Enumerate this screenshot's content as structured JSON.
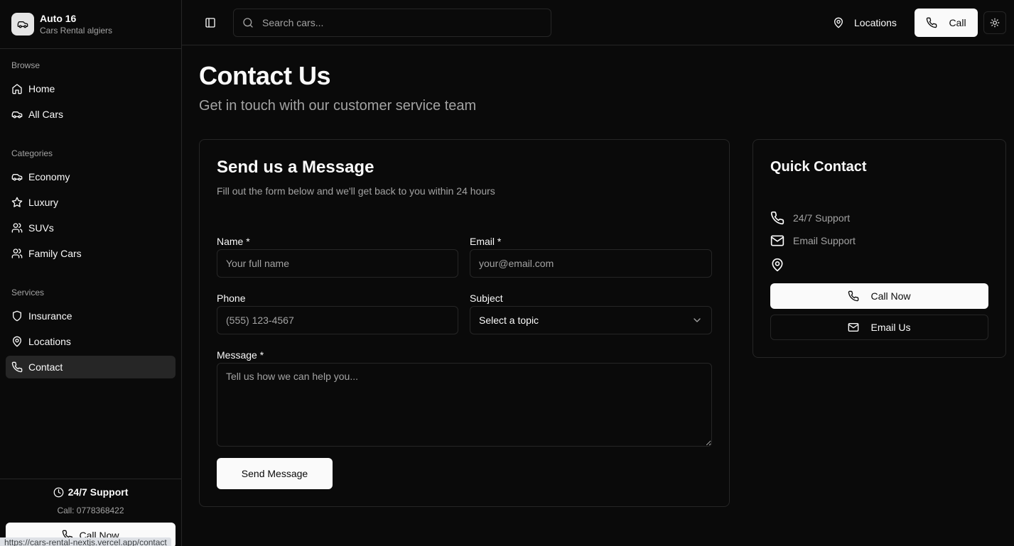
{
  "brand": {
    "title": "Auto 16",
    "subtitle": "Cars Rental algiers"
  },
  "sidebar": {
    "groups": [
      {
        "label": "Browse",
        "items": [
          {
            "label": "Home",
            "icon": "home-icon"
          },
          {
            "label": "All Cars",
            "icon": "car-icon"
          }
        ]
      },
      {
        "label": "Categories",
        "items": [
          {
            "label": "Economy",
            "icon": "car-icon"
          },
          {
            "label": "Luxury",
            "icon": "star-icon"
          },
          {
            "label": "SUVs",
            "icon": "users-icon"
          },
          {
            "label": "Family Cars",
            "icon": "users-icon"
          }
        ]
      },
      {
        "label": "Services",
        "items": [
          {
            "label": "Insurance",
            "icon": "shield-icon"
          },
          {
            "label": "Locations",
            "icon": "map-pin-icon"
          },
          {
            "label": "Contact",
            "icon": "phone-icon",
            "active": true
          }
        ]
      }
    ],
    "footer": {
      "support": "24/7 Support",
      "call_text": "Call: 0778368422",
      "call_button": "Call Now"
    }
  },
  "statusbar": {
    "url": "https://cars-rental-nextjs.vercel.app/contact"
  },
  "header": {
    "search_placeholder": "Search cars...",
    "locations_label": "Locations",
    "call_label": "Call"
  },
  "page": {
    "title": "Contact Us",
    "subtitle": "Get in touch with our customer service team"
  },
  "form": {
    "title": "Send us a Message",
    "description": "Fill out the form below and we'll get back to you within 24 hours",
    "name_label": "Name *",
    "name_placeholder": "Your full name",
    "email_label": "Email *",
    "email_placeholder": "your@email.com",
    "phone_label": "Phone",
    "phone_placeholder": "(555) 123-4567",
    "subject_label": "Subject",
    "subject_value": "Select a topic",
    "message_label": "Message *",
    "message_placeholder": "Tell us how we can help you...",
    "submit": "Send Message"
  },
  "quick_contact": {
    "title": "Quick Contact",
    "support": "24/7 Support",
    "email_support": "Email Support",
    "call_now": "Call Now",
    "email_us": "Email Us"
  },
  "colors": {
    "background": "#0a0a0a",
    "border": "#262626",
    "muted": "#a3a3a3",
    "primary": "#fafafa",
    "active_bg": "#262626"
  }
}
